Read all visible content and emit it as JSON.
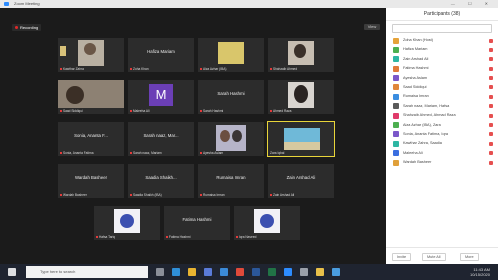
{
  "window": {
    "title": "Zoom Meeting",
    "controls": "— ☐ ✕"
  },
  "stage": {
    "recording_label": "Recording",
    "view_button": "View"
  },
  "tiles": [
    {
      "name": "",
      "caption": "Kawthar Zahra"
    },
    {
      "name": "Hafiza Mariam",
      "caption": "Zoha Khan"
    },
    {
      "name": "",
      "caption": "Aiza Azhar (IBA)"
    },
    {
      "name": "",
      "caption": "Shahzaib Ahmed"
    },
    {
      "name": "",
      "caption": "Saad Siddiqui"
    },
    {
      "name": "",
      "caption": "Maleeha Ali"
    },
    {
      "name": "Sarah Hashmi",
      "caption": "Sarah Hashmi"
    },
    {
      "name": "",
      "caption": "Ahmed Raza"
    },
    {
      "name": "Sonia, Ananta F...",
      "caption": "Sonia, Ananta Fatima"
    },
    {
      "name": "Sarah naaz, Mar...",
      "caption": "Sarah naaz, Mariam"
    },
    {
      "name": "",
      "caption": "Ayesha Aslam"
    },
    {
      "name": "",
      "caption": "Zara Iqbal"
    },
    {
      "name": "Wardah Basheer",
      "caption": "Wardah Basheer"
    },
    {
      "name": "Saadia Shaikh...",
      "caption": "Saadia Shaikh (IBA)"
    },
    {
      "name": "Rumaisa Imran",
      "caption": "Rumaisa Imran"
    },
    {
      "name": "Zain Arshad Ali",
      "caption": "Zain Arshad Ali"
    },
    {
      "name": "",
      "caption": "Hafsa Tariq"
    },
    {
      "name": "Fatima Hashmi",
      "caption": "Fatima Hashmi"
    },
    {
      "name": "",
      "caption": "Iqra Naveed"
    }
  ],
  "participants": {
    "header": "Participants (38)",
    "search_placeholder": "",
    "list": [
      {
        "name": "Zoha Khan (Host)",
        "color": "#e6a33a"
      },
      {
        "name": "Hafiza Mariam",
        "color": "#4caf50"
      },
      {
        "name": "Zain Arshad Ali",
        "color": "#2db6a3"
      },
      {
        "name": "Fatima Hashmi",
        "color": "#e07a3a"
      },
      {
        "name": "Ayesha Aslam",
        "color": "#7b57c9"
      },
      {
        "name": "Saad Siddiqui",
        "color": "#e0863a"
      },
      {
        "name": "Rumaisa Imran",
        "color": "#3a8de0"
      },
      {
        "name": "Sarah naaz, Mariam, Hafsa",
        "color": "#5a5a5a"
      },
      {
        "name": "Shahzaib Ahmed, Ahmad Raza",
        "color": "#e03a6a"
      },
      {
        "name": "Aiza Azhar (IBA), Zara",
        "color": "#4caf50"
      },
      {
        "name": "Sonia, Ananta Fatima, Iqra",
        "color": "#7b57c9"
      },
      {
        "name": "Kawthar Zahra, Saadia",
        "color": "#2db6a3"
      },
      {
        "name": "Maleeha Ali",
        "color": "#3a6ee0"
      },
      {
        "name": "Wardah Basheer",
        "color": "#e0a03a"
      }
    ],
    "invite_label": "Invite",
    "mute_all_label": "Mute All",
    "more_label": "More"
  },
  "taskbar": {
    "search_placeholder": "Type here to search",
    "time": "11:43 AM",
    "date": "10/15/2020"
  }
}
